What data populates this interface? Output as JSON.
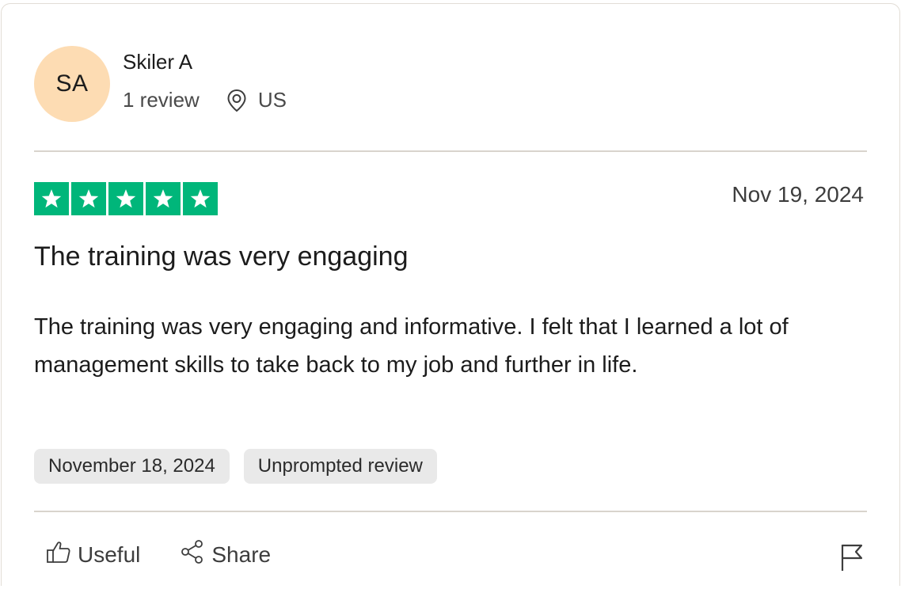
{
  "reviewer": {
    "initials": "SA",
    "name": "Skiler A",
    "review_count": "1 review",
    "location": "US",
    "avatar_color": "#fddcb3"
  },
  "review": {
    "rating": 5,
    "max_rating": 5,
    "star_color": "#00b67a",
    "date": "Nov 19, 2024",
    "title": "The training was very engaging",
    "body": "The training was very engaging and informative. I felt that I learned a lot of management skills to take back to my job and further in life.",
    "tags": [
      "November 18, 2024",
      "Unprompted review"
    ]
  },
  "actions": {
    "useful_label": "Useful",
    "share_label": "Share",
    "useful_icon": "thumbs-up-icon",
    "share_icon": "share-icon",
    "report_icon": "flag-icon"
  }
}
